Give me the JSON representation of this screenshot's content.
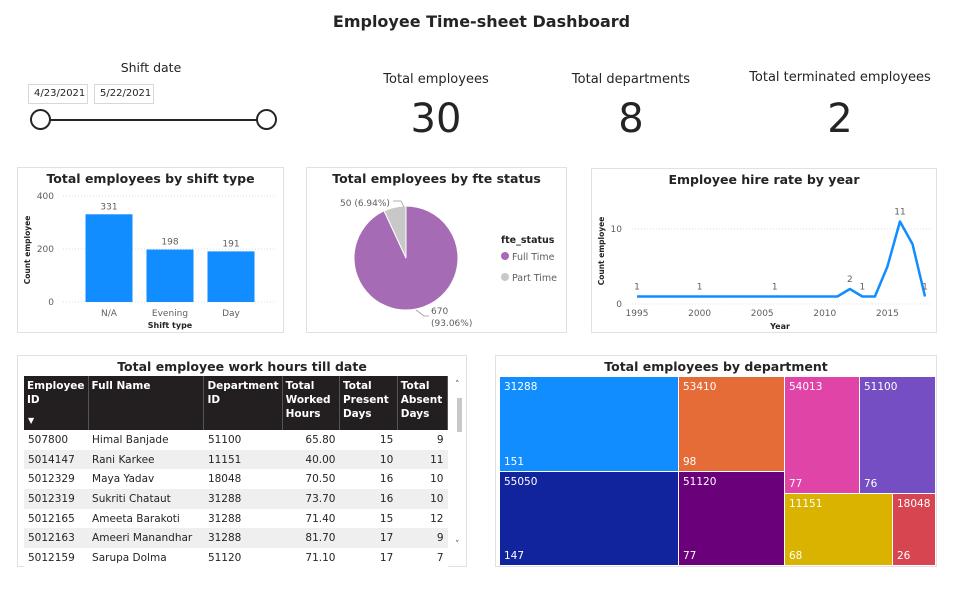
{
  "dashboard": {
    "title": "Employee Time-sheet Dashboard"
  },
  "slicer": {
    "title": "Shift date",
    "start_date": "4/23/2021",
    "end_date": "5/22/2021",
    "range_start": 0,
    "range_end": 1
  },
  "cards": [
    {
      "label": "Total employees",
      "value": "30"
    },
    {
      "label": "Total departments",
      "value": "8"
    },
    {
      "label": "Total terminated employees",
      "value": "2"
    }
  ],
  "shift_chart": {
    "title": "Total employees by shift type",
    "ylabel": "Count employee",
    "xlabel": "Shift type",
    "yticks": [
      "400",
      "200",
      "0"
    ],
    "bar_color": "#118DFF",
    "chart_data": {
      "type": "bar",
      "categories": [
        "N/A",
        "Evening",
        "Day"
      ],
      "values": [
        331,
        198,
        191
      ],
      "ylim": [
        0,
        400
      ],
      "xlabel": "Shift type",
      "ylabel": "Count employee",
      "title": "Total employees by shift type"
    }
  },
  "fte_chart": {
    "title": "Total employees by fte status",
    "legend_title": "fte_status",
    "slice_labels": [
      "670",
      "(93.06%)",
      "50 (6.94%)"
    ],
    "chart_data": {
      "type": "pie",
      "categories": [
        "Full Time",
        "Part Time"
      ],
      "values": [
        670,
        50
      ],
      "percents": [
        93.06,
        6.94
      ],
      "colors": [
        "#A66BB5",
        "#C8C8C8"
      ],
      "legend": "right"
    }
  },
  "hire_chart": {
    "title": "Employee hire rate by year",
    "ylabel": "Count employee",
    "xlabel": "Year",
    "xticks": [
      "1995",
      "2000",
      "2005",
      "2010",
      "2015"
    ],
    "yticks": [
      "10",
      "0"
    ],
    "line_color": "#118DFF",
    "data_labels": [
      "1",
      "1",
      "1",
      "2",
      "1",
      "11",
      "1"
    ],
    "chart_data": {
      "type": "line",
      "x": [
        1995,
        2000,
        2006,
        2010,
        2011,
        2012,
        2013,
        2014,
        2015,
        2016,
        2017,
        2018
      ],
      "y": [
        1,
        1,
        1,
        1,
        1,
        2,
        1,
        1,
        5,
        11,
        8,
        1
      ],
      "xlim": [
        1994,
        2018
      ],
      "ylim": [
        0,
        12
      ],
      "title": "Employee hire rate by year",
      "xlabel": "Year",
      "ylabel": "Count employee"
    }
  },
  "hours_table": {
    "title": "Total employee work hours till date",
    "columns": [
      "Employee ID",
      "Full Name",
      "Department ID",
      "Total Worked Hours",
      "Total Present Days",
      "Total Absent Days"
    ],
    "rows": [
      [
        "507800",
        "Himal Banjade",
        "51100",
        "65.80",
        "15",
        "9"
      ],
      [
        "5014147",
        "Rani Karkee",
        "11151",
        "40.00",
        "10",
        "11"
      ],
      [
        "5012329",
        "Maya Yadav",
        "18048",
        "70.50",
        "16",
        "10"
      ],
      [
        "5012319",
        "Sukriti Chataut",
        "31288",
        "73.70",
        "16",
        "10"
      ],
      [
        "5012165",
        "Ameeta Barakoti",
        "31288",
        "71.40",
        "15",
        "12"
      ],
      [
        "5012163",
        "Ameeri Manandhar",
        "31288",
        "81.70",
        "17",
        "9"
      ],
      [
        "5012159",
        "Sarupa Dolma",
        "51120",
        "71.10",
        "17",
        "7"
      ]
    ]
  },
  "dept_chart": {
    "title": "Total employees by department",
    "chart_data": {
      "type": "treemap",
      "categories": [
        "31288",
        "55050",
        "53410",
        "51120",
        "54013",
        "51100",
        "11151",
        "18048"
      ],
      "values": [
        151,
        147,
        98,
        77,
        77,
        76,
        68,
        26
      ],
      "colors": [
        "#118DFF",
        "#12239E",
        "#E66C37",
        "#6B007B",
        "#E044A7",
        "#744EC2",
        "#D9B300",
        "#D64550"
      ]
    }
  }
}
